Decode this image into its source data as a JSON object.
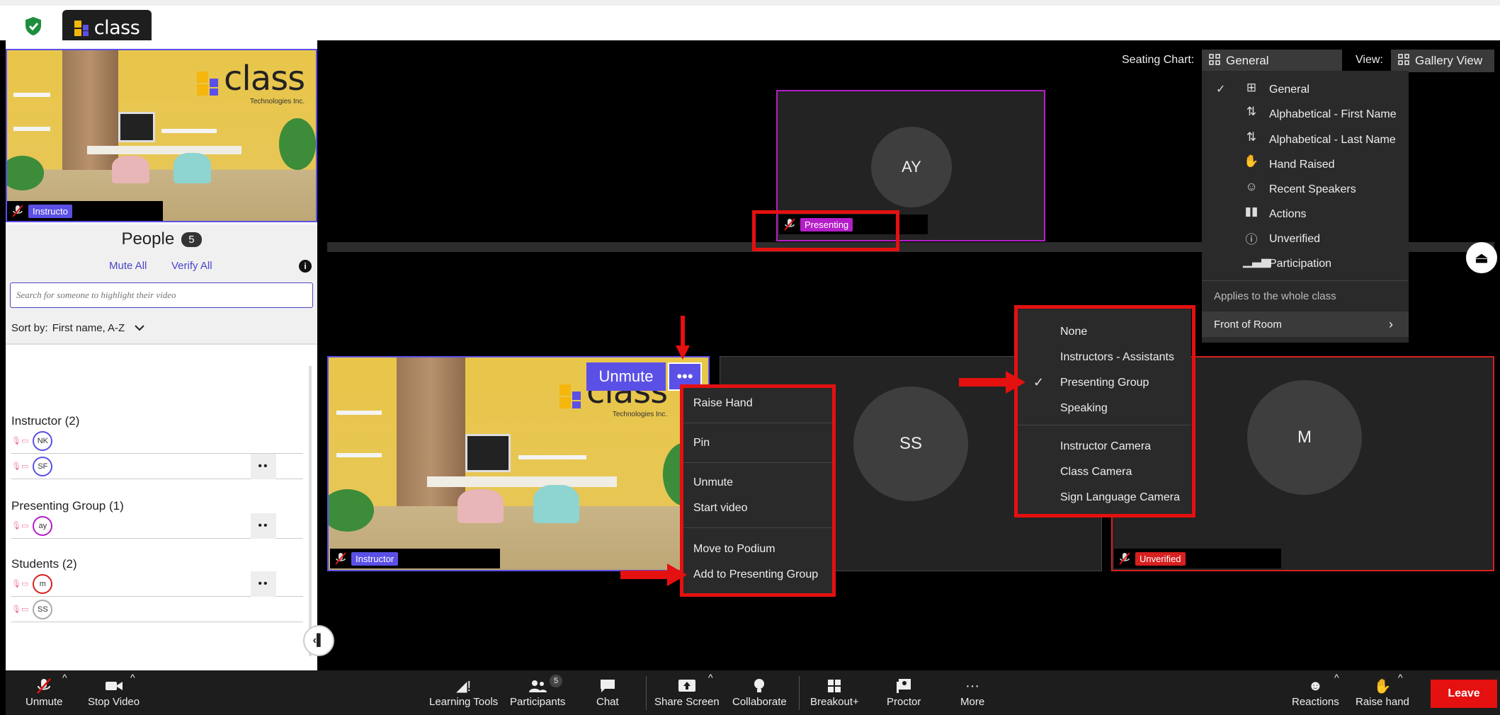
{
  "app": {
    "title": "class"
  },
  "self_video": {
    "tag": "Instructo",
    "brand_word": "class",
    "brand_sub": "Technologies Inc."
  },
  "people": {
    "title": "People",
    "count": "5",
    "mute_all": "Mute All",
    "verify_all": "Verify All",
    "search_placeholder": "Search for someone to highlight their video",
    "sort_label": "Sort by:",
    "sort_value": "First name, A-Z",
    "groups": [
      {
        "title": "Instructor (2)",
        "members": [
          {
            "initials": "NK",
            "color": "#5b50e6"
          },
          {
            "initials": "SF",
            "color": "#5b50e6"
          }
        ]
      },
      {
        "title": "Presenting Group  (1)",
        "members": [
          {
            "initials": "ay",
            "color": "#b41ec8"
          }
        ]
      },
      {
        "title": "Students  (2)",
        "members": [
          {
            "initials": "m",
            "color": "#d72020"
          },
          {
            "initials": "SS",
            "color": "#aaaaaa"
          }
        ]
      }
    ],
    "dots": "••"
  },
  "controls": {
    "seating_label": "Seating Chart:",
    "seating_value": "General",
    "view_label": "View:",
    "view_value": "Gallery View"
  },
  "tiles": {
    "ay": {
      "initials": "AY",
      "tag": "Presenting"
    },
    "instructor": {
      "tag": "Instructor",
      "unmute": "Unmute",
      "more": "•••",
      "brand_word": "class",
      "brand_sub": "Technologies Inc."
    },
    "ss": {
      "initials": "SS"
    },
    "m": {
      "initials": "M",
      "tag": "Unverified"
    }
  },
  "tile_menu": {
    "items": [
      "Raise Hand",
      "Pin",
      "Unmute",
      "Start video",
      "Move to Podium",
      "Add to Presenting Group"
    ]
  },
  "layout_menu": {
    "items": [
      "None",
      "Instructors - Assistants",
      "Presenting Group",
      "Speaking",
      "Instructor Camera",
      "Class Camera",
      "Sign Language Camera"
    ],
    "checked": "Presenting Group"
  },
  "seating_menu": {
    "items": [
      "General",
      "Alphabetical - First Name",
      "Alphabetical - Last Name",
      "Hand Raised",
      "Recent Speakers",
      "Actions",
      "Unverified",
      "Participation"
    ],
    "checked": "General",
    "applies": "Applies to the whole class",
    "front_of_room": "Front of Room"
  },
  "toolbar": {
    "unmute": "Unmute",
    "stop_video": "Stop Video",
    "learning_tools": "Learning Tools",
    "participants": "Participants",
    "participants_count": "5",
    "chat": "Chat",
    "share_screen": "Share Screen",
    "collaborate": "Collaborate",
    "breakout": "Breakout+",
    "proctor": "Proctor",
    "more": "More",
    "reactions": "Reactions",
    "raise_hand": "Raise hand",
    "leave": "Leave"
  },
  "colors": {
    "accent": "#5b50e6",
    "presenting": "#b41ec8",
    "unverified": "#d72020",
    "annotation_red": "#e51010"
  }
}
